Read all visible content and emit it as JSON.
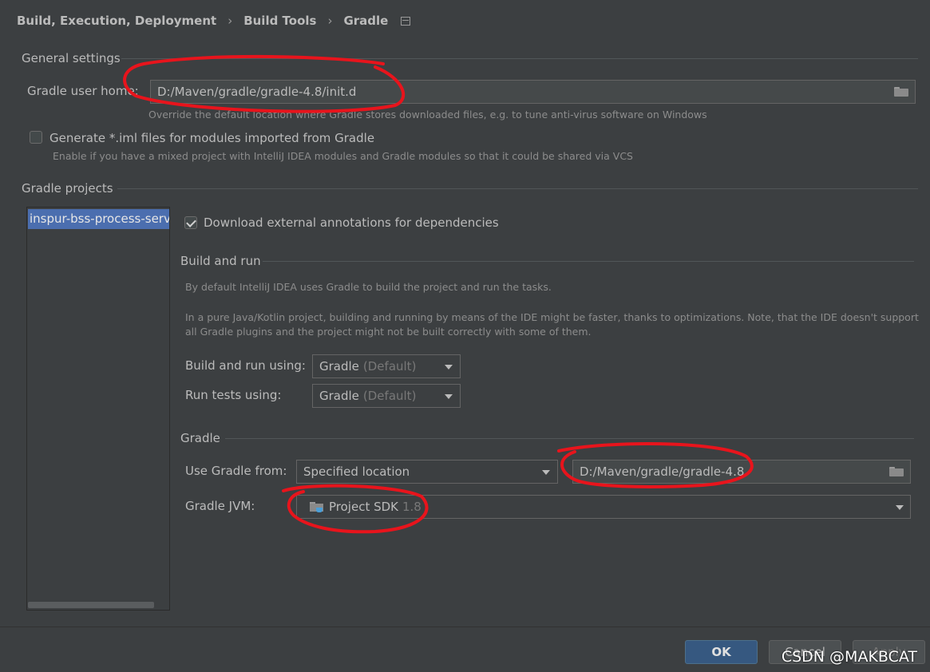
{
  "breadcrumb": {
    "items": [
      "Build, Execution, Deployment",
      "Build Tools",
      "Gradle"
    ],
    "separator": "›",
    "icon": "settings-scope-icon"
  },
  "general_settings": {
    "title": "General settings",
    "gradle_user_home_label": "Gradle user home:",
    "gradle_user_home_value": "D:/Maven/gradle/gradle-4.8/init.d",
    "gradle_user_home_hint": "Override the default location where Gradle stores downloaded files, e.g. to tune anti-virus software on Windows",
    "generate_iml_label": "Generate *.iml files for modules imported from Gradle",
    "generate_iml_checked": false,
    "generate_iml_hint": "Enable if you have a mixed project with IntelliJ IDEA modules and Gradle modules so that it could be shared via VCS"
  },
  "gradle_projects": {
    "title": "Gradle projects",
    "items": [
      "inspur-bss-process-service"
    ],
    "selected_index": 0
  },
  "project_settings": {
    "download_annotations_label": "Download external annotations for dependencies",
    "download_annotations_checked": true,
    "build_and_run": {
      "title": "Build and run",
      "desc1": "By default IntelliJ IDEA uses Gradle to build the project and run the tasks.",
      "desc2_line1": "In a pure Java/Kotlin project, building and running by means of the IDE might be faster, thanks to optimizations. Note, that the IDE doesn't support",
      "desc2_line2": "all Gradle plugins and the project might not be built correctly with some of them.",
      "build_run_using_label": "Build and run using:",
      "build_run_using_value": "Gradle",
      "build_run_using_suffix": "(Default)",
      "run_tests_using_label": "Run tests using:",
      "run_tests_using_value": "Gradle",
      "run_tests_using_suffix": "(Default)"
    },
    "gradle": {
      "title": "Gradle",
      "use_gradle_from_label": "Use Gradle from:",
      "use_gradle_from_value": "Specified location",
      "gradle_location_value": "D:/Maven/gradle/gradle-4.8",
      "gradle_jvm_label": "Gradle JVM:",
      "gradle_jvm_value": "Project SDK",
      "gradle_jvm_version": "1.8"
    }
  },
  "buttons": {
    "ok": "OK",
    "cancel": "Cancel",
    "apply": "Apply"
  },
  "watermark": "CSDN @MAKBCAT",
  "colors": {
    "background": "#3c3f41",
    "selection": "#4b6eaf",
    "ok_button": "#365880",
    "annotation_red": "#e8141c"
  }
}
